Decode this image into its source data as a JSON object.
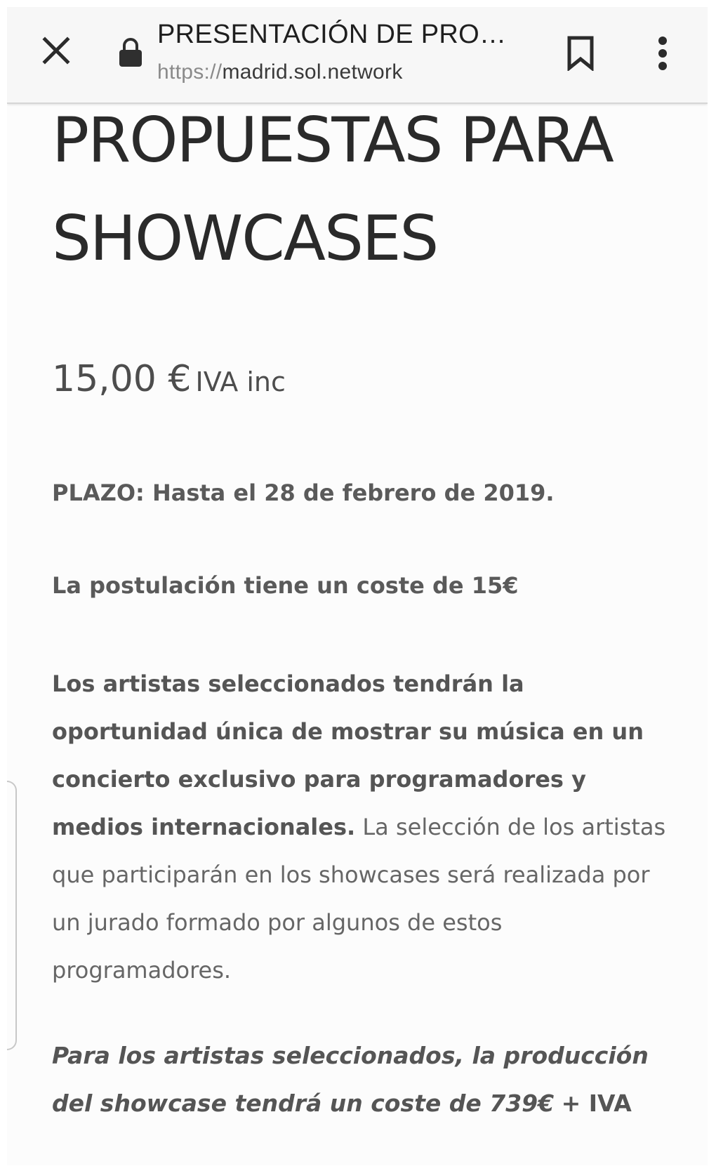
{
  "toolbar": {
    "title": "PRESENTACIÓN DE PRO…",
    "url_scheme": "https://",
    "url_host": "madrid.sol.network",
    "close_icon": "close-icon",
    "lock_icon": "lock-icon",
    "bookmark_icon": "bookmark-icon",
    "menu_icon": "more-vert-icon"
  },
  "content": {
    "heading": "PROPUESTAS PARA SHOWCASES",
    "price_amount": "15,00 €",
    "price_suffix": "IVA inc",
    "deadline": "PLAZO: Hasta el 28 de febrero de 2019.",
    "cost_note": "La postulación tiene un coste de 15€",
    "description_bold": "Los artistas seleccionados tendrán la oportunidad única de mostrar su música en un concierto exclusivo para programadores y medios internacionales.",
    "description_regular": "La selección de los artistas que participarán en los showcases será realizada por un jurado formado por algunos de estos programadores.",
    "production_italic": "Para los artistas seleccionados, la producción del showcase tendrá un coste de 739€",
    "production_tail": "+ IVA"
  },
  "colors": {
    "toolbar_bg": "#f7f7f7",
    "page_bg": "#fcfcfc",
    "heading_text": "#2a2a2a",
    "body_text": "#5a5a5a"
  }
}
